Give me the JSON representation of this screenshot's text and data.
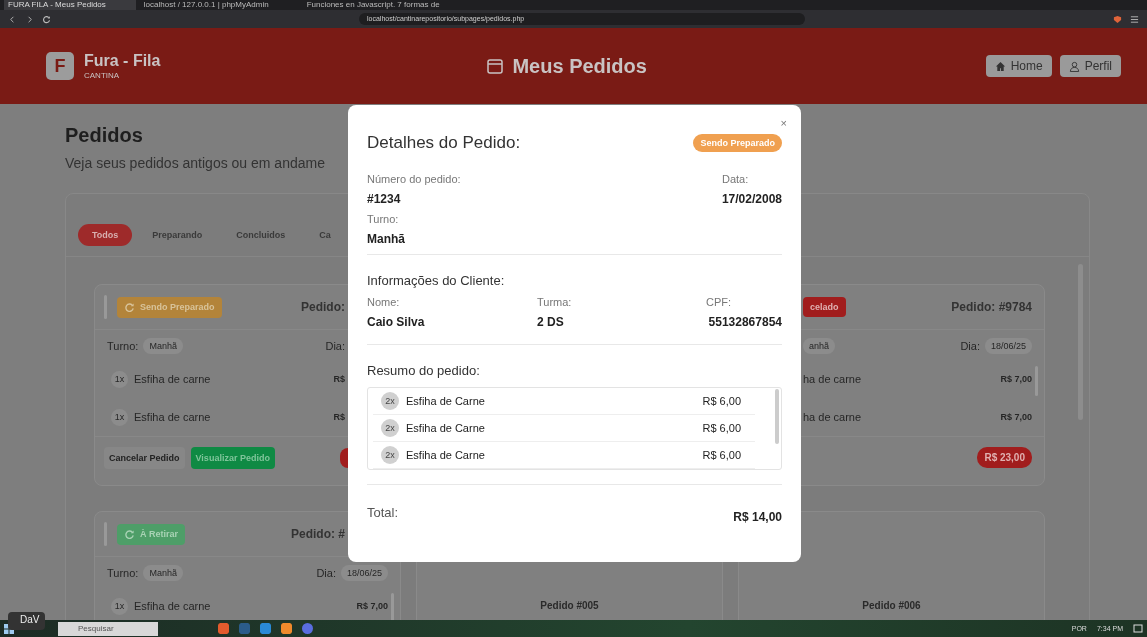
{
  "browser": {
    "tabs": [
      {
        "title": "FURA FILA - Meus Pedidos",
        "selected": true
      },
      {
        "title": "localhost / 127.0.0.1 | phpMyAdmin",
        "selected": false
      },
      {
        "title": "Funciones en Javascript. 7 formas de",
        "selected": false
      }
    ],
    "address": "localhost/cantinarepositorio/subpages/pedidos.php"
  },
  "header": {
    "brand_letter": "F",
    "brand": "Fura - Fila",
    "brand_sub": "CANTINA",
    "title": "Meus Pedidos",
    "buttons": [
      {
        "label": "Home",
        "kind": "home"
      },
      {
        "label": "Perfil",
        "kind": "profile"
      }
    ]
  },
  "page": {
    "title": "Pedidos",
    "subtitle": "Veja seus pedidos antigos ou em andame"
  },
  "filters": [
    {
      "label": "Todos",
      "selected": true
    },
    {
      "label": "Preparando",
      "selected": false
    },
    {
      "label": "Concluidos",
      "selected": false
    },
    {
      "label": "Ca",
      "selected": false
    }
  ],
  "orders": [
    {
      "kind": "cut_right",
      "status": {
        "label": "Sendo Preparado",
        "kind": "preparing"
      },
      "order": "Pedido:",
      "shift_label": "Turno:",
      "shift": "Manhã",
      "day_label": "Dia:",
      "items": [
        {
          "qty": "1x",
          "name": "Esfiha de carne",
          "price": "R$"
        },
        {
          "qty": "1x",
          "name": "Esfiha de carne",
          "price": "R$"
        }
      ],
      "actions": [
        {
          "label": "Cancelar Pedido",
          "kind": "secondary"
        },
        {
          "label": "Visualizar Pedido",
          "kind": "primary"
        }
      ]
    },
    {
      "kind": "cut_left",
      "status": {
        "label": "celado",
        "kind": "cancelled"
      },
      "order": "Pedido: #9784",
      "shift": "anhã",
      "day_label": "Dia:",
      "day": "18/06/25",
      "items": [
        {
          "name": "ha de carne",
          "price": "R$ 7,00"
        },
        {
          "name": "ha de carne",
          "price": "R$ 7,00"
        }
      ],
      "total": "R$ 23,00"
    },
    {
      "kind": "cut_top_right",
      "status": {
        "label": "À Retirar",
        "kind": "ready"
      },
      "order": "Pedido: #",
      "shift_label": "Turno:",
      "shift": "Manhã",
      "day_label": "Dia:",
      "day": "18/06/25",
      "items": [
        {
          "qty": "1x",
          "name": "Esfiha de carne",
          "price": "R$ 7,00"
        }
      ]
    },
    {
      "kind": "lower",
      "title": "Pedido #005"
    },
    {
      "kind": "lower",
      "title": "Pedido #006"
    }
  ],
  "modal": {
    "close": "×",
    "title": "Detalhes do Pedido:",
    "status": "Sendo Preparado",
    "order_number_label": "Número do pedido:",
    "order_number": "#1234",
    "date_label": "Data:",
    "date": "17/02/2008",
    "shift_label": "Turno:",
    "shift": "Manhã",
    "client_heading": "Informações do Cliente:",
    "client_fields": [
      {
        "label": "Nome:",
        "value": "Caio Silva"
      },
      {
        "label": "Turma:",
        "value": "2 DS"
      },
      {
        "label": "CPF:",
        "value": "55132867854"
      }
    ],
    "summary_heading": "Resumo do pedido:",
    "items": [
      {
        "qty": "2x",
        "name": "Esfiha de Carne",
        "price": "R$ 6,00"
      },
      {
        "qty": "2x",
        "name": "Esfiha de Carne",
        "price": "R$ 6,00"
      },
      {
        "qty": "2x",
        "name": "Esfiha de Carne",
        "price": "R$ 6,00"
      }
    ],
    "total_label": "Total:",
    "total": "R$ 14,00"
  },
  "taskbar": {
    "widget": "DaV",
    "search_placeholder": "Pesquisar",
    "language": "POR",
    "time": "7:34 PM"
  }
}
